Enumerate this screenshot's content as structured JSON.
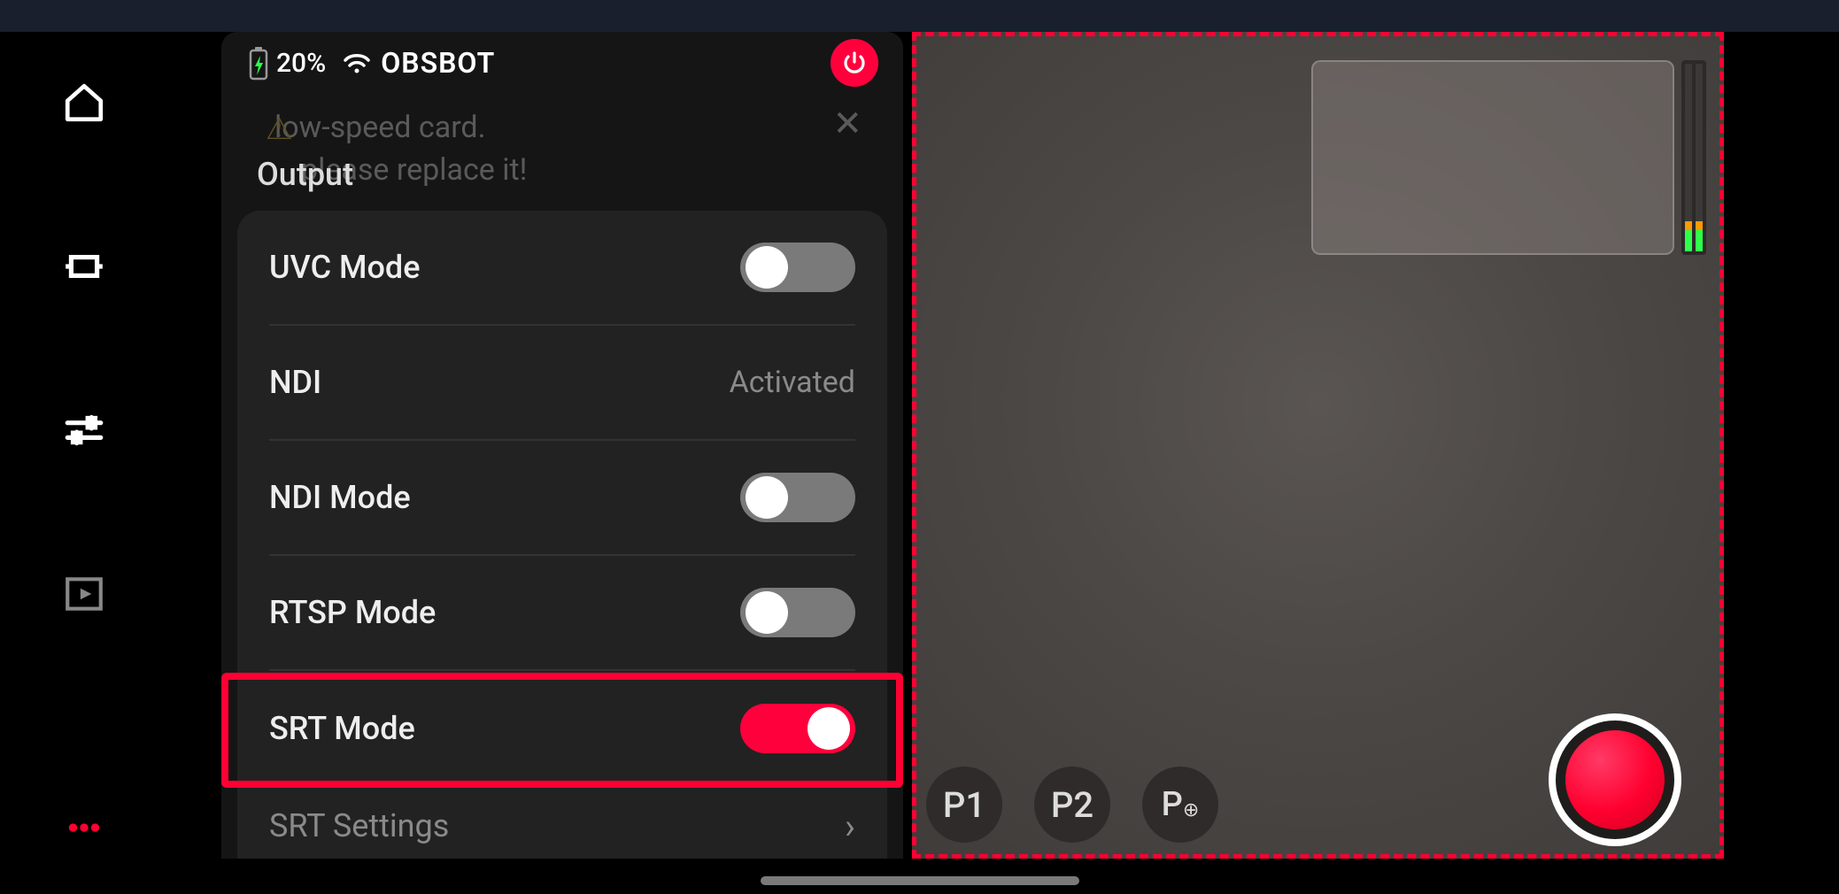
{
  "header": {
    "battery_pct": "20%",
    "ssid": "OBSBOT"
  },
  "warning": {
    "line1": "low-speed card.",
    "line2": "please replace it!"
  },
  "section_title": "Output",
  "rows": {
    "uvc_label": "UVC Mode",
    "ndi_label": "NDI",
    "ndi_value": "Activated",
    "ndi_mode_label": "NDI Mode",
    "rtsp_label": "RTSP Mode",
    "srt_label": "SRT Mode",
    "srt_settings_label": "SRT Settings"
  },
  "presets": {
    "p1": "P1",
    "p2": "P2",
    "p_add": "P"
  }
}
